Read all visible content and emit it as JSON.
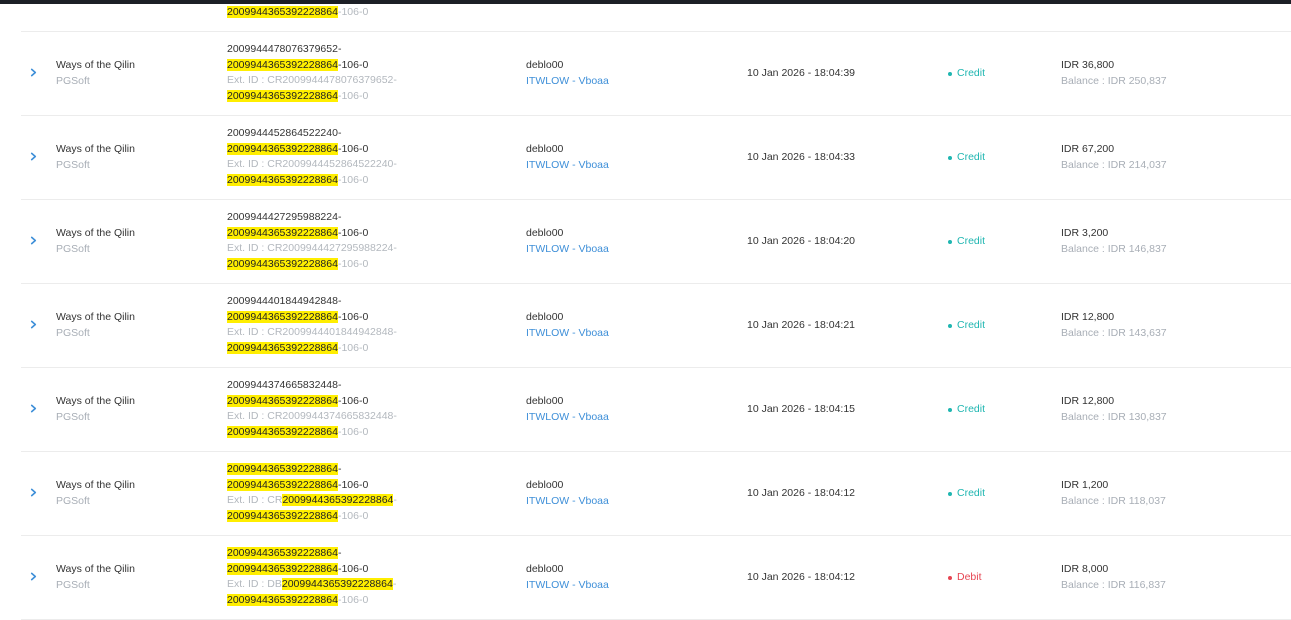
{
  "highlight_term": "2009944365392228864",
  "partial_row": {
    "tx_tail": "-106-0"
  },
  "rows": [
    {
      "game": "Ways of the Qilin",
      "provider": "PGSoft",
      "tx_prefix": "2009944478076379652-",
      "tx_prefix_highlight": false,
      "tx_suffix": "-106-0",
      "ext_label": "Ext. ID : ",
      "ext_prefix": "CR2009944478076379652-",
      "ext_prefix_highlight": false,
      "ext_suffix": "-106-0",
      "user": "deblo00",
      "agent": "ITWLOW - Vboaa",
      "datetime": "10 Jan 2026 - 18:04:39",
      "status": "Credit",
      "status_color": "#1fb6b1",
      "amount": "IDR 36,800",
      "balance": "Balance : IDR 250,837"
    },
    {
      "game": "Ways of the Qilin",
      "provider": "PGSoft",
      "tx_prefix": "2009944452864522240-",
      "tx_prefix_highlight": false,
      "tx_suffix": "-106-0",
      "ext_label": "Ext. ID : ",
      "ext_prefix": "CR2009944452864522240-",
      "ext_prefix_highlight": false,
      "ext_suffix": "-106-0",
      "user": "deblo00",
      "agent": "ITWLOW - Vboaa",
      "datetime": "10 Jan 2026 - 18:04:33",
      "status": "Credit",
      "status_color": "#1fb6b1",
      "amount": "IDR 67,200",
      "balance": "Balance : IDR 214,037"
    },
    {
      "game": "Ways of the Qilin",
      "provider": "PGSoft",
      "tx_prefix": "2009944427295988224-",
      "tx_prefix_highlight": false,
      "tx_suffix": "-106-0",
      "ext_label": "Ext. ID : ",
      "ext_prefix": "CR2009944427295988224-",
      "ext_prefix_highlight": false,
      "ext_suffix": "-106-0",
      "user": "deblo00",
      "agent": "ITWLOW - Vboaa",
      "datetime": "10 Jan 2026 - 18:04:20",
      "status": "Credit",
      "status_color": "#1fb6b1",
      "amount": "IDR 3,200",
      "balance": "Balance : IDR 146,837"
    },
    {
      "game": "Ways of the Qilin",
      "provider": "PGSoft",
      "tx_prefix": "2009944401844942848-",
      "tx_prefix_highlight": false,
      "tx_suffix": "-106-0",
      "ext_label": "Ext. ID : ",
      "ext_prefix": "CR2009944401844942848-",
      "ext_prefix_highlight": false,
      "ext_suffix": "-106-0",
      "user": "deblo00",
      "agent": "ITWLOW - Vboaa",
      "datetime": "10 Jan 2026 - 18:04:21",
      "status": "Credit",
      "status_color": "#1fb6b1",
      "amount": "IDR 12,800",
      "balance": "Balance : IDR 143,637"
    },
    {
      "game": "Ways of the Qilin",
      "provider": "PGSoft",
      "tx_prefix": "2009944374665832448-",
      "tx_prefix_highlight": false,
      "tx_suffix": "-106-0",
      "ext_label": "Ext. ID : ",
      "ext_prefix": "CR2009944374665832448-",
      "ext_prefix_highlight": false,
      "ext_suffix": "-106-0",
      "user": "deblo00",
      "agent": "ITWLOW - Vboaa",
      "datetime": "10 Jan 2026 - 18:04:15",
      "status": "Credit",
      "status_color": "#1fb6b1",
      "amount": "IDR 12,800",
      "balance": "Balance : IDR 130,837"
    },
    {
      "game": "Ways of the Qilin",
      "provider": "PGSoft",
      "tx_prefix": "2009944365392228864",
      "tx_prefix_highlight": true,
      "tx_prefix_tail": "-",
      "tx_suffix": "-106-0",
      "ext_label": "Ext. ID : ",
      "ext_prefix": "CR",
      "ext_prefix_highlight": true,
      "ext_prefix_tail": "-",
      "ext_suffix": "-106-0",
      "user": "deblo00",
      "agent": "ITWLOW - Vboaa",
      "datetime": "10 Jan 2026 - 18:04:12",
      "status": "Credit",
      "status_color": "#1fb6b1",
      "amount": "IDR 1,200",
      "balance": "Balance : IDR 118,037"
    },
    {
      "game": "Ways of the Qilin",
      "provider": "PGSoft",
      "tx_prefix": "2009944365392228864",
      "tx_prefix_highlight": true,
      "tx_prefix_tail": "-",
      "tx_suffix": "-106-0",
      "ext_label": "Ext. ID : ",
      "ext_prefix": "DB",
      "ext_prefix_highlight": true,
      "ext_prefix_tail": "-",
      "ext_suffix": "-106-0",
      "user": "deblo00",
      "agent": "ITWLOW - Vboaa",
      "datetime": "10 Jan 2026 - 18:04:12",
      "status": "Debit",
      "status_color": "#e64552",
      "amount": "IDR 8,000",
      "balance": "Balance : IDR 116,837"
    }
  ],
  "colors": {
    "accent_link": "#3e8fd8",
    "highlight": "#ffee00",
    "credit": "#1fb6b1",
    "debit": "#e64552"
  },
  "icons": {
    "expand": "chevron-right-icon"
  }
}
